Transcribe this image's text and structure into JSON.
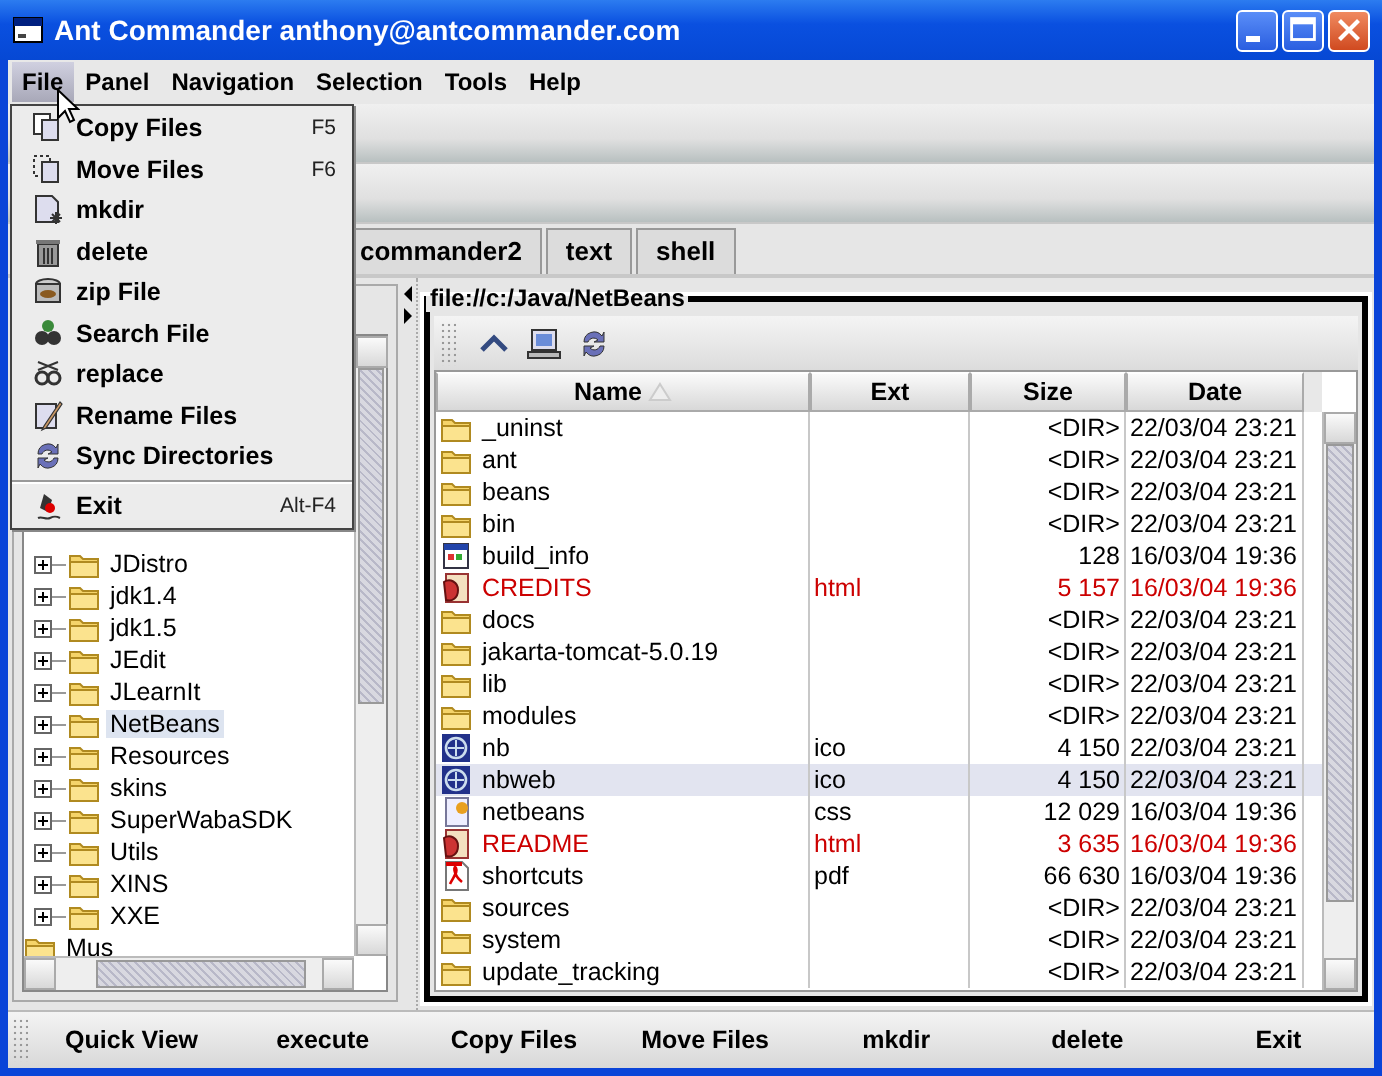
{
  "window": {
    "title": "Ant Commander anthony@antcommander.com"
  },
  "menubar": [
    {
      "label": "File",
      "selected": true
    },
    {
      "label": "Panel",
      "selected": false
    },
    {
      "label": "Navigation",
      "selected": false
    },
    {
      "label": "Selection",
      "selected": false
    },
    {
      "label": "Tools",
      "selected": false
    },
    {
      "label": "Help",
      "selected": false
    }
  ],
  "file_menu": [
    {
      "kind": "copy",
      "label": "Copy Files",
      "shortcut": "F5"
    },
    {
      "kind": "move",
      "label": "Move Files",
      "shortcut": "F6"
    },
    {
      "kind": "mkdir",
      "label": "mkdir"
    },
    {
      "kind": "trash",
      "label": "delete"
    },
    {
      "kind": "zip",
      "label": "zip File"
    },
    {
      "kind": "search",
      "label": "Search File"
    },
    {
      "kind": "replace",
      "label": "replace"
    },
    {
      "kind": "rename",
      "label": "Rename Files"
    },
    {
      "kind": "sync",
      "label": "Sync Directories"
    },
    {
      "kind": "separator"
    },
    {
      "kind": "exit",
      "label": "Exit",
      "shortcut": "Alt-F4"
    }
  ],
  "tabs": [
    {
      "label": "commander2",
      "selected": false
    },
    {
      "label": "text",
      "selected": false
    },
    {
      "label": "shell",
      "selected": false
    }
  ],
  "tree": [
    {
      "children": [
        {
          "label": "JDistro",
          "expanded": false,
          "selected": false
        },
        {
          "label": "jdk1.4",
          "expanded": false,
          "selected": false
        },
        {
          "label": "jdk1.5",
          "expanded": false,
          "selected": false
        },
        {
          "label": "JEdit",
          "expanded": false,
          "selected": false
        },
        {
          "label": "JLearnIt",
          "expanded": false,
          "selected": false
        },
        {
          "label": "NetBeans",
          "expanded": false,
          "selected": true
        },
        {
          "label": "Resources",
          "expanded": false,
          "selected": false
        },
        {
          "label": "skins",
          "expanded": false,
          "selected": false
        },
        {
          "label": "SuperWabaSDK",
          "expanded": false,
          "selected": false
        },
        {
          "label": "Utils",
          "expanded": false,
          "selected": false
        },
        {
          "label": "XINS",
          "expanded": false,
          "selected": false
        },
        {
          "label": "XXE",
          "expanded": false,
          "selected": false
        }
      ]
    },
    {
      "label": "Mus",
      "selected": false
    }
  ],
  "file_panel": {
    "path": "file://c:/Java/NetBeans",
    "columns": [
      {
        "label": "Name",
        "sorted": true
      },
      {
        "label": "Ext",
        "sorted": false
      },
      {
        "label": "Size",
        "sorted": false
      },
      {
        "label": "Date",
        "sorted": false
      }
    ],
    "rows": [
      {
        "kind": "folder",
        "name": "_uninst",
        "size": "<DIR>",
        "date": "22/03/04 23:21",
        "color": "#000000",
        "selected": false
      },
      {
        "kind": "folder",
        "name": "ant",
        "size": "<DIR>",
        "date": "22/03/04 23:21",
        "color": "#000000",
        "selected": false
      },
      {
        "kind": "folder",
        "name": "beans",
        "size": "<DIR>",
        "date": "22/03/04 23:21",
        "color": "#000000",
        "selected": false
      },
      {
        "kind": "folder",
        "name": "bin",
        "size": "<DIR>",
        "date": "22/03/04 23:21",
        "color": "#000000",
        "selected": false
      },
      {
        "kind": "app",
        "name": "build_info",
        "size": "128",
        "date": "16/03/04 19:36",
        "color": "#000000",
        "selected": false
      },
      {
        "kind": "html",
        "name": "CREDITS",
        "ext": "html",
        "size": "5 157",
        "date": "16/03/04 19:36",
        "color": "#cc0000",
        "selected": false
      },
      {
        "kind": "folder",
        "name": "docs",
        "size": "<DIR>",
        "date": "22/03/04 23:21",
        "color": "#000000",
        "selected": false
      },
      {
        "kind": "folder",
        "name": "jakarta-tomcat-5.0.19",
        "size": "<DIR>",
        "date": "22/03/04 23:21",
        "color": "#000000",
        "selected": false
      },
      {
        "kind": "folder",
        "name": "lib",
        "size": "<DIR>",
        "date": "22/03/04 23:21",
        "color": "#000000",
        "selected": false
      },
      {
        "kind": "folder",
        "name": "modules",
        "size": "<DIR>",
        "date": "22/03/04 23:21",
        "color": "#000000",
        "selected": false
      },
      {
        "kind": "ico",
        "name": "nb",
        "ext": "ico",
        "size": "4 150",
        "date": "22/03/04 23:21",
        "color": "#000000",
        "selected": false
      },
      {
        "kind": "ico",
        "name": "nbweb",
        "ext": "ico",
        "size": "4 150",
        "date": "22/03/04 23:21",
        "color": "#000000",
        "selected": true
      },
      {
        "kind": "css",
        "name": "netbeans",
        "ext": "css",
        "size": "12 029",
        "date": "16/03/04 19:36",
        "color": "#000000",
        "selected": false
      },
      {
        "kind": "html",
        "name": "README",
        "ext": "html",
        "size": "3 635",
        "date": "16/03/04 19:36",
        "color": "#cc0000",
        "selected": false
      },
      {
        "kind": "pdf",
        "name": "shortcuts",
        "ext": "pdf",
        "size": "66 630",
        "date": "16/03/04 19:36",
        "color": "#000000",
        "selected": false
      },
      {
        "kind": "folder",
        "name": "sources",
        "size": "<DIR>",
        "date": "22/03/04 23:21",
        "color": "#000000",
        "selected": false
      },
      {
        "kind": "folder",
        "name": "system",
        "size": "<DIR>",
        "date": "22/03/04 23:21",
        "color": "#000000",
        "selected": false
      },
      {
        "kind": "folder",
        "name": "update_tracking",
        "size": "<DIR>",
        "date": "22/03/04 23:21",
        "color": "#000000",
        "selected": false
      }
    ]
  },
  "bottom_buttons": [
    "Quick View",
    "execute",
    "Copy Files",
    "Move Files",
    "mkdir",
    "delete",
    "Exit"
  ]
}
